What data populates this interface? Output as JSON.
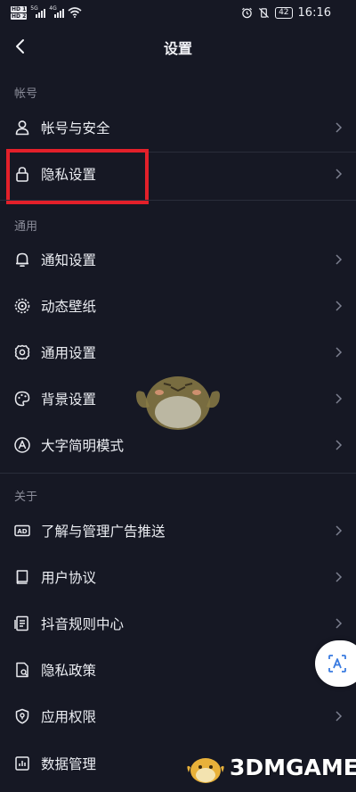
{
  "status_bar": {
    "sim1": "HD 1",
    "sim2": "HD 2",
    "network1": "5G",
    "network2": "4G",
    "alarm_icon": "alarm-icon",
    "mute_icon": "vibrate-mute-icon",
    "battery": "42",
    "time": "16:16"
  },
  "header": {
    "back_icon": "chevron-left-icon",
    "title": "设置"
  },
  "sections": {
    "account": "帐号",
    "general": "通用",
    "about": "关于"
  },
  "items": {
    "account_security": {
      "label": "帐号与安全",
      "icon": "person-icon"
    },
    "privacy_settings": {
      "label": "隐私设置",
      "icon": "lock-icon"
    },
    "notification_settings": {
      "label": "通知设置",
      "icon": "bell-icon"
    },
    "live_wallpaper": {
      "label": "动态壁纸",
      "icon": "wallpaper-icon"
    },
    "general_settings": {
      "label": "通用设置",
      "icon": "gear-icon"
    },
    "background_settings": {
      "label": "背景设置",
      "icon": "palette-icon"
    },
    "large_font_mode": {
      "label": "大字简明模式",
      "icon": "font-a-icon"
    },
    "ad_management": {
      "label": "了解与管理广告推送",
      "icon": "ad-icon"
    },
    "user_agreement": {
      "label": "用户协议",
      "icon": "book-icon"
    },
    "rules_center": {
      "label": "抖音规则中心",
      "icon": "document-icon"
    },
    "privacy_policy": {
      "label": "隐私政策",
      "icon": "policy-icon"
    },
    "app_permissions": {
      "label": "应用权限",
      "icon": "shield-icon"
    },
    "data_management": {
      "label": "数据管理",
      "icon": "data-icon"
    }
  },
  "highlight_color": "#e3202a",
  "translate_button_icon": "translate-icon",
  "watermark": {
    "text": "3DMGAME"
  }
}
